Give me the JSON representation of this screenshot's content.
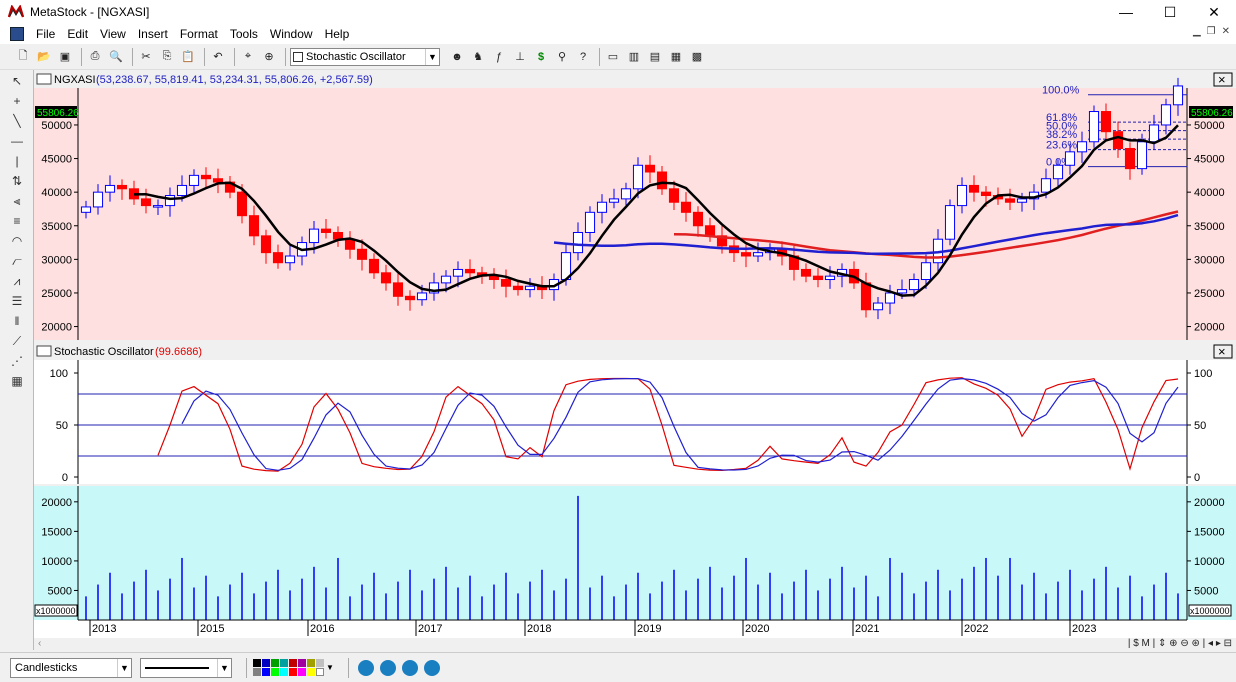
{
  "window": {
    "title": "MetaStock - [NGXASI]",
    "minimize": "—",
    "maximize": "☐",
    "close": "✕"
  },
  "menu": [
    "File",
    "Edit",
    "View",
    "Insert",
    "Format",
    "Tools",
    "Window",
    "Help"
  ],
  "toolbar": {
    "indicator_select": "Stochastic Oscillator"
  },
  "price_pane": {
    "header_name": "NGXASI",
    "header_values": "(53,238.67, 55,819.41, 53,234.31, 55,806.26, +2,567.59)",
    "last_price_label": "55806.26",
    "y_ticks": [
      "50000",
      "45000",
      "40000",
      "35000",
      "30000",
      "25000",
      "20000"
    ],
    "fib_labels": [
      "100.0%",
      "61.8%",
      "50.0%",
      "38.2%",
      "23.6%",
      "0.0%"
    ],
    "close_button": "×"
  },
  "stoch_pane": {
    "header_name": "Stochastic Oscillator",
    "header_value": "(99.6686)",
    "y_ticks": [
      "100",
      "50",
      "0"
    ],
    "close_button": "×"
  },
  "volume_pane": {
    "y_ticks": [
      "20000",
      "15000",
      "10000",
      "5000"
    ],
    "unit_label": "x1000000"
  },
  "x_axis": {
    "years": [
      "2013",
      "2015",
      "2016",
      "2017",
      "2018",
      "2019",
      "2020",
      "2021",
      "2022",
      "2023"
    ]
  },
  "statusbar": {
    "chart_style": "Candlesticks"
  },
  "colors": {
    "price_bg": "#ffe0e0",
    "stoch_bg": "#ffffff",
    "volume_bg": "#c8f8f8",
    "up": "#0000ff",
    "down": "#ff0000",
    "ma_short": "#000000",
    "ma_mid": "#2020d0",
    "ma_long": "#e02020"
  },
  "chart_data": {
    "type": "candlestick",
    "title": "NGXASI",
    "monthly_close_approx": [
      37800,
      40000,
      41000,
      40500,
      39000,
      38000,
      38000,
      39500,
      41000,
      42500,
      42000,
      41500,
      40000,
      36500,
      33500,
      31000,
      29500,
      30500,
      32500,
      34500,
      34000,
      33000,
      31500,
      30000,
      28000,
      26500,
      24500,
      24000,
      25000,
      26500,
      27500,
      28500,
      28000,
      27500,
      27000,
      26000,
      25500,
      26000,
      25500,
      27000,
      31000,
      34000,
      37000,
      38500,
      39000,
      40500,
      44000,
      43000,
      40500,
      38500,
      37000,
      35000,
      33500,
      32000,
      31000,
      30500,
      31000,
      31500,
      30500,
      28500,
      27500,
      27000,
      27500,
      28500,
      26500,
      22500,
      23500,
      25000,
      25500,
      27000,
      29500,
      33000,
      38000,
      41000,
      40000,
      39500,
      39000,
      38500,
      39000,
      40000,
      42000,
      44000,
      46000,
      47500,
      52000,
      49000,
      46500,
      43500,
      47500,
      50000,
      53000,
      55806
    ]
  }
}
